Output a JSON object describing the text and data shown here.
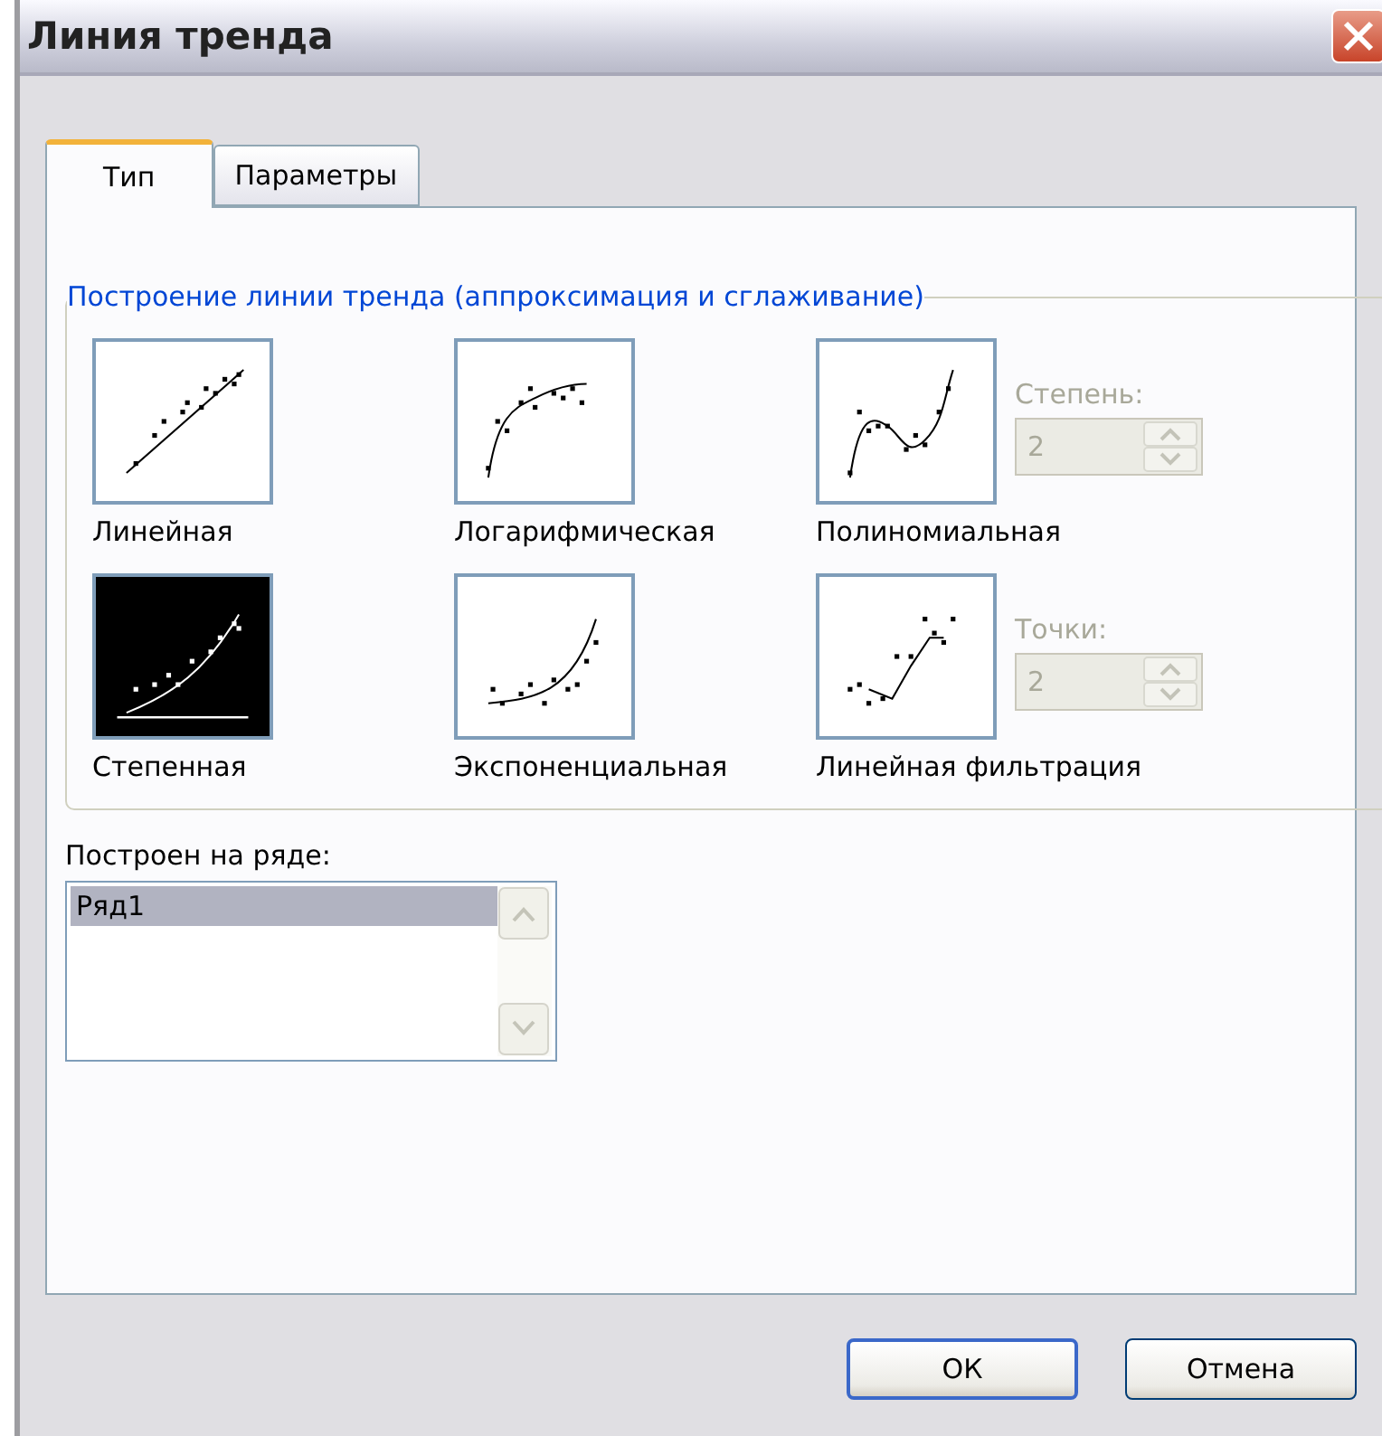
{
  "window": {
    "title": "Линия тренда"
  },
  "tabs": [
    {
      "label": "Тип",
      "selected": true
    },
    {
      "label": "Параметры",
      "selected": false
    }
  ],
  "trend_group": {
    "title": "Построение линии тренда (аппроксимация и сглаживание)",
    "types": [
      {
        "kind": "linear",
        "label": "Линейная",
        "selected": false
      },
      {
        "kind": "logarithmic",
        "label": "Логарифмическая",
        "selected": false
      },
      {
        "kind": "polynomial",
        "label": "Полиномиальная",
        "selected": false
      },
      {
        "kind": "power",
        "label": "Степенная",
        "selected": true
      },
      {
        "kind": "exponential",
        "label": "Экспоненциальная",
        "selected": false
      },
      {
        "kind": "moving_average",
        "label": "Линейная фильтрация",
        "selected": false
      }
    ],
    "spinners": [
      {
        "label": "Степень:",
        "value": "2",
        "disabled": true
      },
      {
        "label": "Точки:",
        "value": "2",
        "disabled": true
      }
    ]
  },
  "series": {
    "label": "Построен на ряде:",
    "items": [
      {
        "label": "Ряд1",
        "selected": true
      }
    ]
  },
  "buttons": [
    {
      "label": "ОК",
      "default": true
    },
    {
      "label": "Отмена",
      "default": false
    }
  ]
}
